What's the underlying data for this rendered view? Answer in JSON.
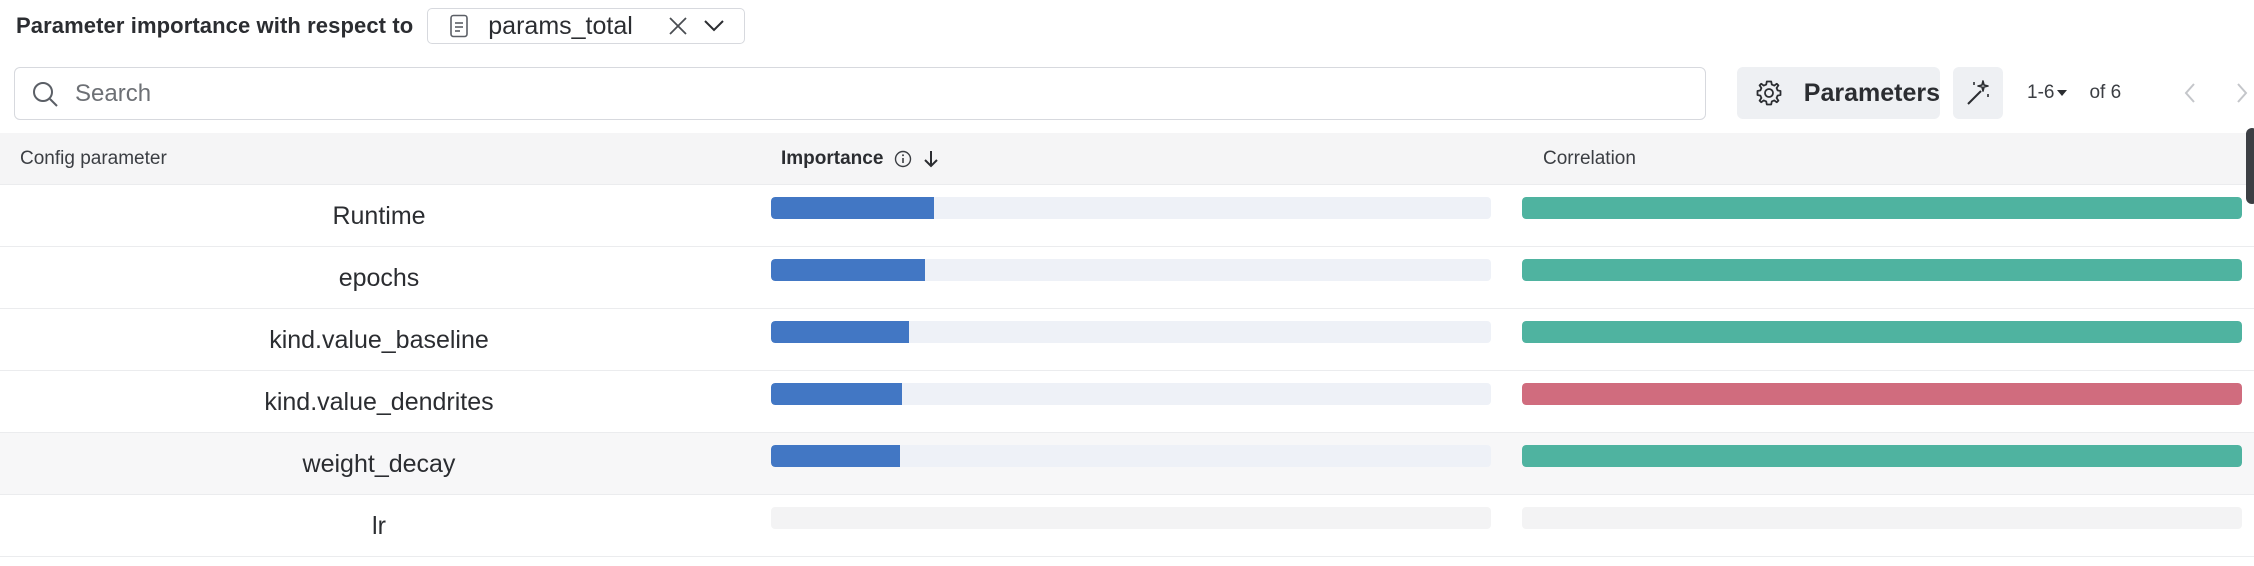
{
  "header": {
    "title": "Parameter importance with respect to",
    "metric": "params_total"
  },
  "search": {
    "placeholder": "Search",
    "value": ""
  },
  "toolbar": {
    "parameters_label": "Parameters"
  },
  "pagination": {
    "range": "1-6",
    "total": "of 6"
  },
  "table": {
    "columns": {
      "config": "Config parameter",
      "importance": "Importance",
      "correlation": "Correlation"
    },
    "rows": [
      {
        "name": "Runtime",
        "importance": 0.227,
        "correlation": "positive"
      },
      {
        "name": "epochs",
        "importance": 0.214,
        "correlation": "positive"
      },
      {
        "name": "kind.value_baseline",
        "importance": 0.191,
        "correlation": "positive"
      },
      {
        "name": "kind.value_dendrites",
        "importance": 0.182,
        "correlation": "negative"
      },
      {
        "name": "weight_decay",
        "importance": 0.179,
        "correlation": "positive"
      },
      {
        "name": "lr",
        "importance": null,
        "correlation": null
      }
    ]
  },
  "colors": {
    "importance": "#4277c4",
    "positive": "#4fb3a0",
    "negative": "#d06c7e"
  }
}
